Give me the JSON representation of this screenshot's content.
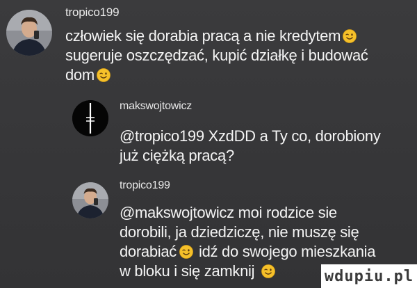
{
  "comments": [
    {
      "username": "tropico199",
      "lines": [
        "człowiek się dorabia pracą a nie kredytem",
        "sugeruje oszczędzać, kupić działkę i budować",
        "dom"
      ],
      "emoji": "winking-face-icon"
    },
    {
      "username": "makswojtowicz",
      "lines": [
        "@tropico199 XzdDD a Ty co, dorobiony",
        "już ciężką pracą?"
      ]
    },
    {
      "username": "tropico199",
      "lines": [
        "@makswojtowicz moi rodzice sie",
        "dorobili, ja dziedziczę, nie muszę się",
        "dorabiać",
        "idź do swojego mieszkania",
        "w bloku i się zamknij"
      ],
      "emoji": "winking-face-icon"
    }
  ],
  "watermark": "wdupiu.pl",
  "colors": {
    "background": "#38383a",
    "text": "#f4f4f4",
    "emoji": "#f5c02a"
  }
}
